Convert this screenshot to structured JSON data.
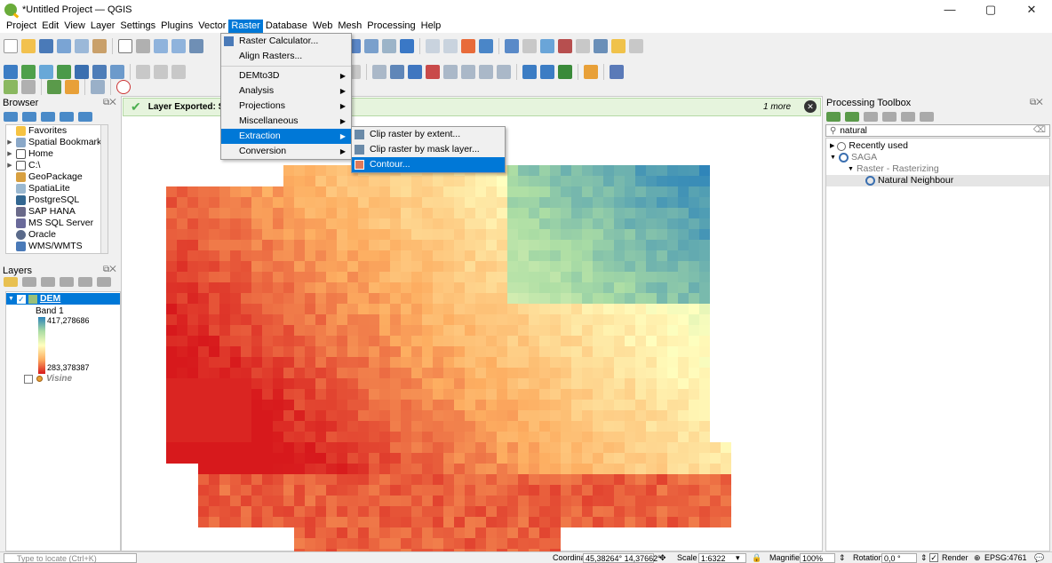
{
  "window": {
    "title": "*Untitled Project — QGIS",
    "minimize": "—",
    "maximize": "▢",
    "close": "✕"
  },
  "menubar": [
    "Project",
    "Edit",
    "View",
    "Layer",
    "Settings",
    "Plugins",
    "Vector",
    "Raster",
    "Database",
    "Web",
    "Mesh",
    "Processing",
    "Help"
  ],
  "raster_menu": {
    "items": [
      "Raster Calculator...",
      "Align Rasters...",
      "DEMto3D",
      "Analysis",
      "Projections",
      "Miscellaneous",
      "Extraction",
      "Conversion"
    ],
    "highlighted": "Extraction"
  },
  "extraction_submenu": {
    "items": [
      "Clip raster by extent...",
      "Clip raster by mask layer...",
      "Contour..."
    ],
    "highlighted": "Contour..."
  },
  "browser": {
    "title": "Browser",
    "items": [
      {
        "label": "Favorites",
        "icon": "star-icon"
      },
      {
        "label": "Spatial Bookmarks",
        "icon": "bookmark-icon"
      },
      {
        "label": "Home",
        "icon": "home-icon"
      },
      {
        "label": "C:\\",
        "icon": "drive-icon"
      },
      {
        "label": "GeoPackage",
        "icon": "geopackage-icon"
      },
      {
        "label": "SpatiaLite",
        "icon": "spatialite-icon"
      },
      {
        "label": "PostgreSQL",
        "icon": "postgresql-icon"
      },
      {
        "label": "SAP HANA",
        "icon": "hana-icon"
      },
      {
        "label": "MS SQL Server",
        "icon": "mssql-icon"
      },
      {
        "label": "Oracle",
        "icon": "oracle-icon"
      },
      {
        "label": "WMS/WMTS",
        "icon": "wms-icon"
      }
    ]
  },
  "layers": {
    "title": "Layers",
    "dem": {
      "name": "DEM",
      "band": "Band 1",
      "max": "417,278686",
      "min": "283,378387"
    },
    "visine": {
      "name": "Visine"
    }
  },
  "message": {
    "text": "Layer Exported: Succ",
    "more": "1 more"
  },
  "toolbox": {
    "title": "Processing Toolbox",
    "search": "natural",
    "recently_used": "Recently used",
    "provider": "SAGA",
    "group": "Raster - Rasterizing",
    "algorithm": "Natural Neighbour"
  },
  "statusbar": {
    "locate_placeholder": "Type to locate (Ctrl+K)",
    "coordinate_label": "Coordinate",
    "coordinate": "45,38264° 14,37662°",
    "scale_label": "Scale",
    "scale": "1:6322",
    "magnifier_label": "Magnifier",
    "magnifier": "100%",
    "rotation_label": "Rotation",
    "rotation": "0,0 °",
    "render_label": "Render",
    "crs": "EPSG:4761"
  },
  "colors": {
    "accent": "#0078d7",
    "raster_low": "#d7191c",
    "raster_mid": "#ffffbf",
    "raster_high": "#2b83ba"
  }
}
